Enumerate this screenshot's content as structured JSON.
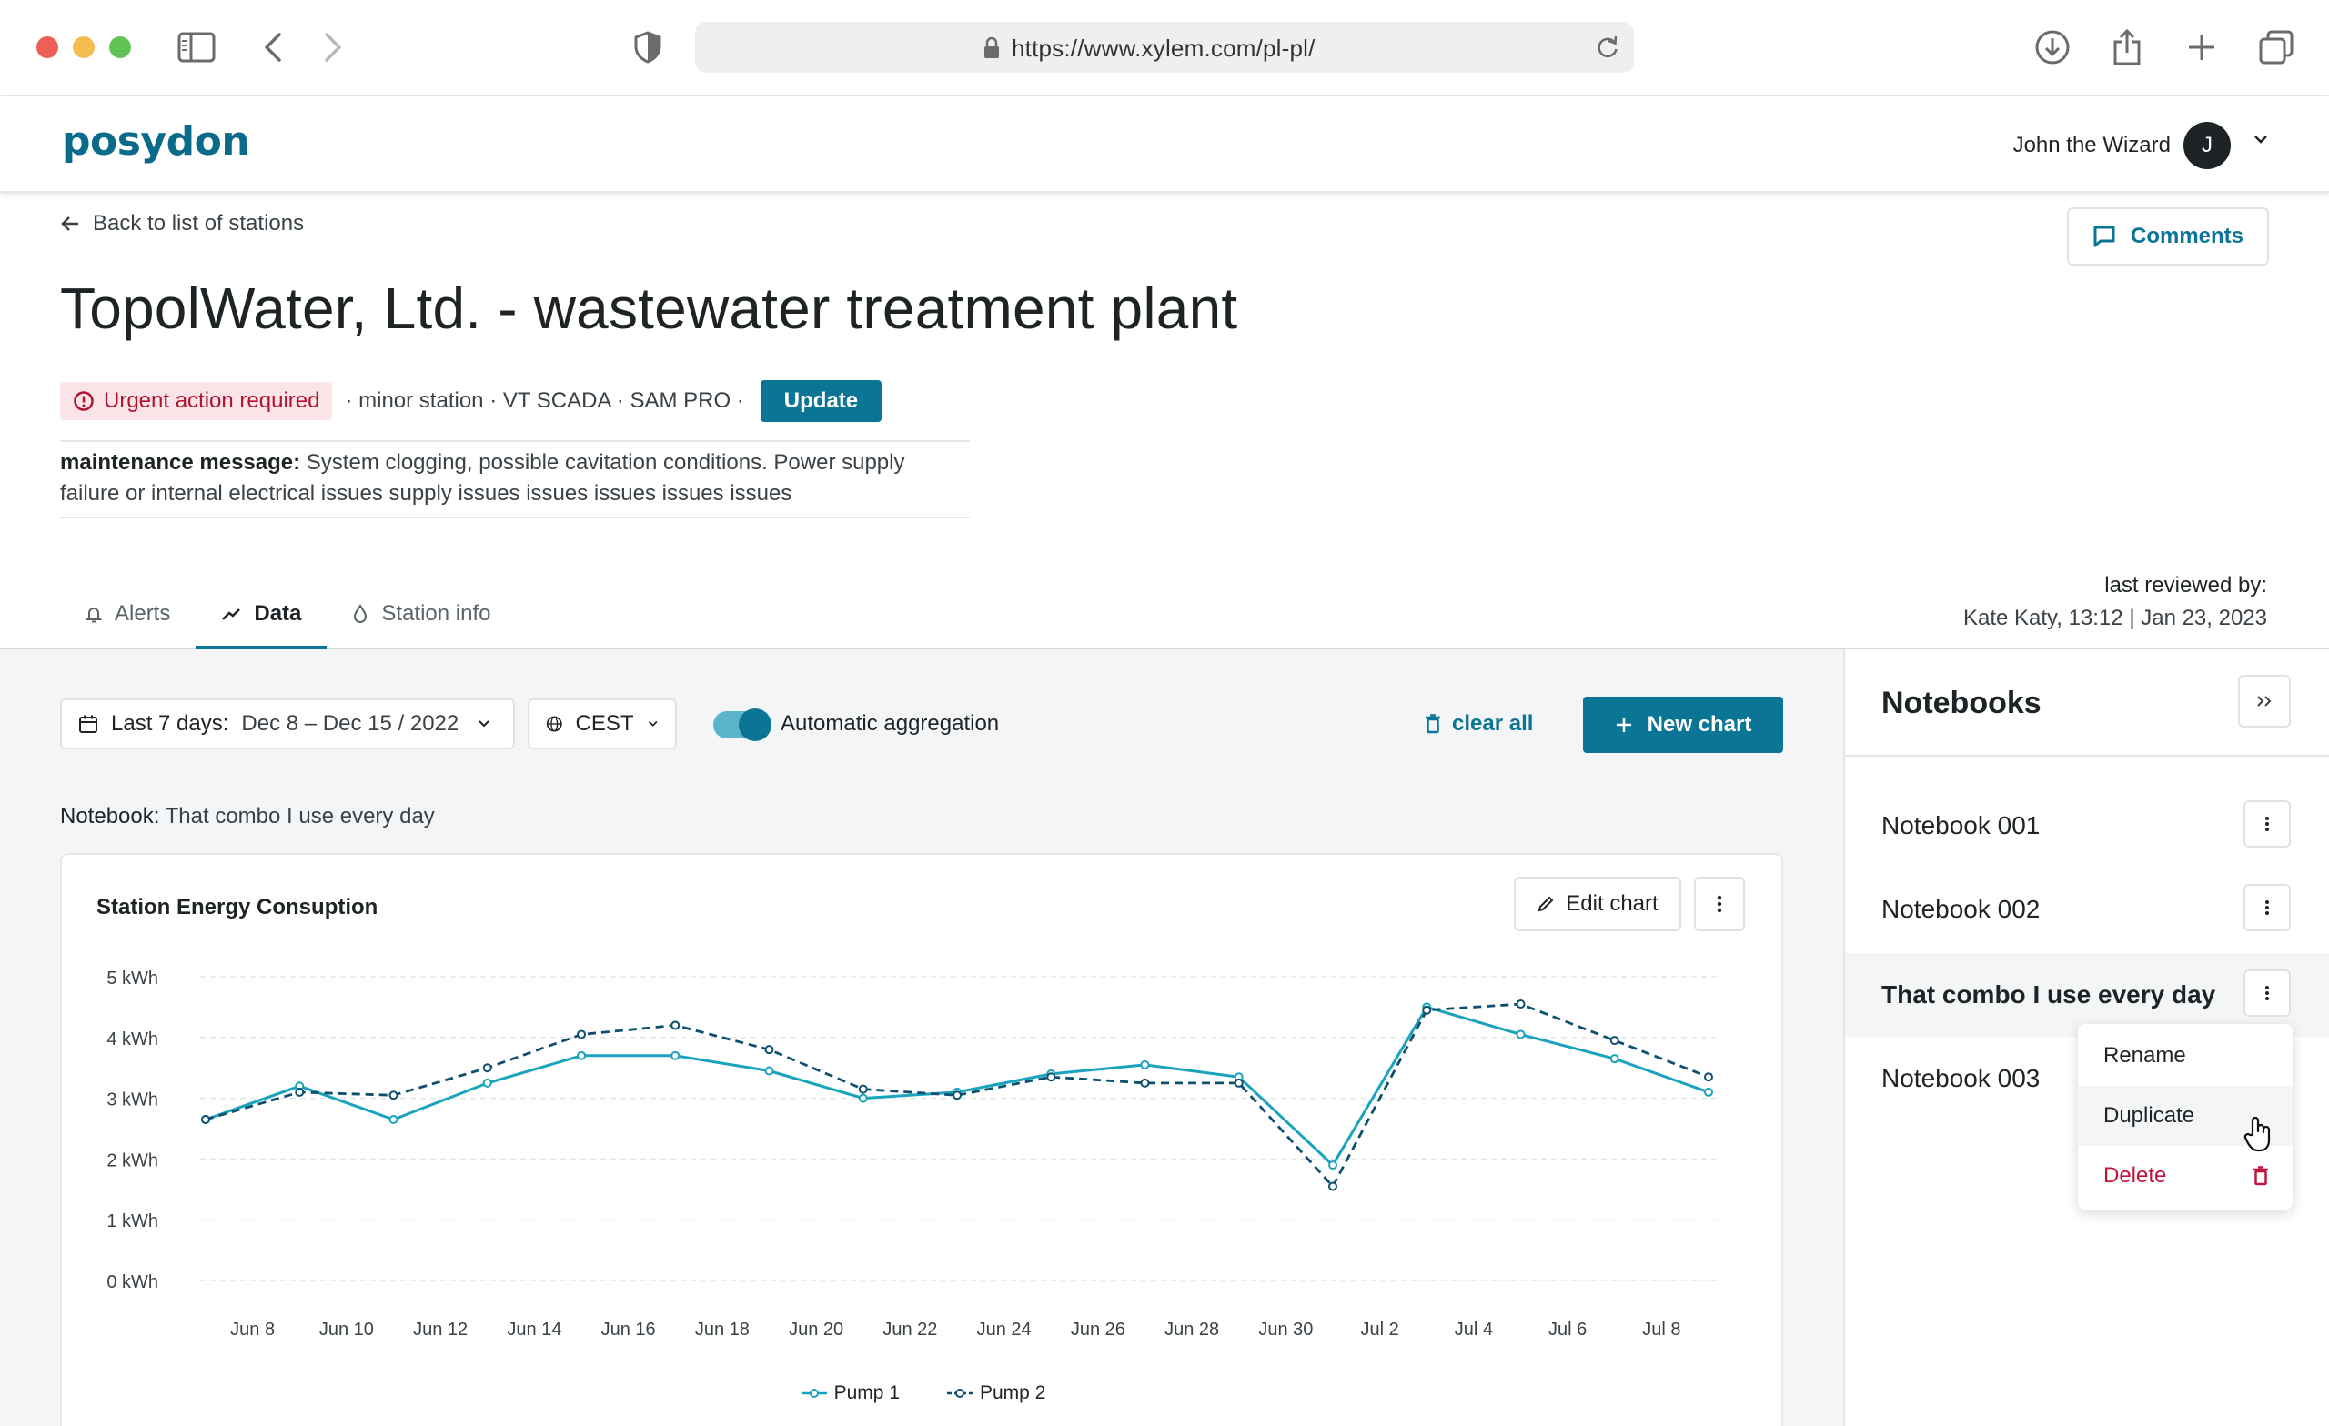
{
  "browser": {
    "url": "https://www.xylem.com/pl-pl/",
    "icons": [
      "sidebar-icon",
      "back-icon",
      "forward-icon",
      "shield-icon",
      "lock-icon",
      "reload-icon",
      "download-icon",
      "share-icon",
      "new-tab-icon",
      "tabs-overview-icon"
    ]
  },
  "header": {
    "logo": "posydon",
    "user_name": "John the Wizard",
    "avatar_initial": "J"
  },
  "station": {
    "back_label": "Back to list of stations",
    "comments_label": "Comments",
    "title": "TopolWater, Ltd. - wastewater treatment plant",
    "urgent_label": "Urgent action required",
    "meta": "· minor station · VT SCADA  · SAM PRO ·",
    "update_label": "Update",
    "maintenance_label": "maintenance message:",
    "maintenance_text": "System clogging, possible cavitation conditions. Power supply failure or internal electrical issues supply issues issues issues issues issues",
    "last_reviewed_label": "last reviewed by:",
    "last_reviewed_value": "Kate Katy, 13:12 | Jan 23, 2023"
  },
  "tabs": [
    {
      "label": "Alerts",
      "icon": "bell-icon",
      "active": false
    },
    {
      "label": "Data",
      "icon": "trend-icon",
      "active": true
    },
    {
      "label": "Station info",
      "icon": "drop-icon",
      "active": false
    }
  ],
  "controls": {
    "date_prefix": "Last 7 days:",
    "date_range": "Dec 8 – Dec 15 / 2022",
    "timezone": "CEST",
    "aggregation_label": "Automatic aggregation",
    "aggregation_on": true,
    "clear_all": "clear all",
    "new_chart": "New chart",
    "notebook_prefix": "Notebook:",
    "notebook_name": "That combo I use every day"
  },
  "chart_card": {
    "title": "Station Energy Consuption",
    "edit_label": "Edit chart"
  },
  "chart_data": {
    "type": "line",
    "title": "Station Energy Consuption",
    "xlabel": "",
    "ylabel": "",
    "ylim": [
      0,
      5
    ],
    "y_ticks": [
      "0 kWh",
      "1 kWh",
      "2 kWh",
      "3 kWh",
      "4 kWh",
      "5 kWh"
    ],
    "x_ticks": [
      "Jun 8",
      "Jun 10",
      "Jun 12",
      "Jun 14",
      "Jun 16",
      "Jun 18",
      "Jun 20",
      "Jun 22",
      "Jun 24",
      "Jun 26",
      "Jun 28",
      "Jun 30",
      "Jul 2",
      "Jul 4",
      "Jul 6",
      "Jul 8"
    ],
    "x": [
      "Jun 7",
      "Jun 9",
      "Jun 11",
      "Jun 13",
      "Jun 15",
      "Jun 17",
      "Jun 19",
      "Jun 21",
      "Jun 23",
      "Jun 25",
      "Jun 27",
      "Jun 29",
      "Jul 1",
      "Jul 3",
      "Jul 5",
      "Jul 7",
      "Jul 9"
    ],
    "grid": true,
    "legend": "bottom",
    "series": [
      {
        "name": "Pump 1",
        "color": "#1aa3bd",
        "dash": false,
        "values": [
          2.65,
          3.2,
          2.65,
          3.25,
          3.7,
          3.7,
          3.45,
          3.0,
          3.1,
          3.4,
          3.55,
          3.35,
          1.9,
          4.5,
          4.05,
          3.65,
          3.1
        ]
      },
      {
        "name": "Pump 2",
        "color": "#0d4f6e",
        "dash": true,
        "values": [
          2.65,
          3.1,
          3.05,
          3.5,
          4.05,
          4.2,
          3.8,
          3.15,
          3.05,
          3.35,
          3.25,
          3.25,
          1.55,
          4.45,
          4.55,
          3.95,
          3.35
        ]
      }
    ]
  },
  "notebooks": {
    "title": "Notebooks",
    "items": [
      {
        "label": "Notebook 001",
        "active": false
      },
      {
        "label": "Notebook 002",
        "active": false
      },
      {
        "label": "That combo I use every day",
        "active": true
      },
      {
        "label": "Notebook 003",
        "active": false
      }
    ]
  },
  "context_menu": {
    "items": [
      {
        "label": "Rename"
      },
      {
        "label": "Duplicate"
      },
      {
        "label": "Delete"
      }
    ]
  }
}
